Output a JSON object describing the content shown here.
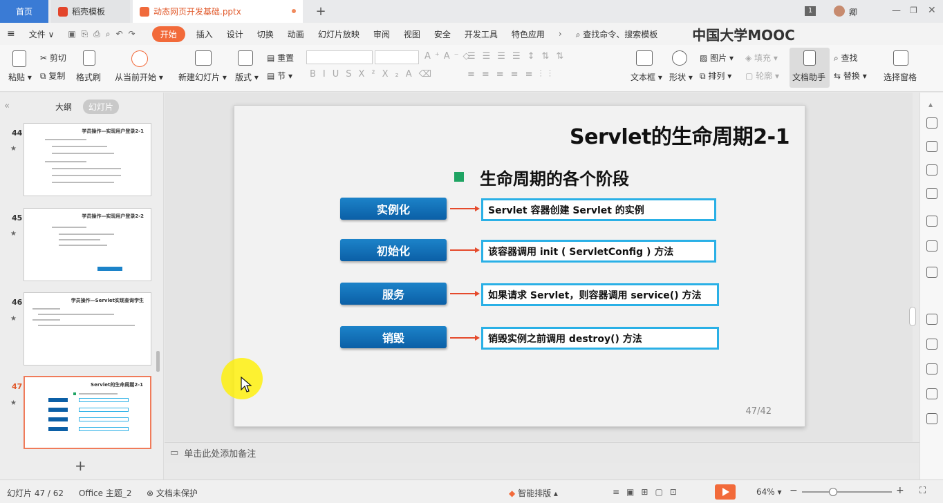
{
  "tabs": {
    "home": "首页",
    "templates": "稻壳模板",
    "document": "动态网页开发基础.pptx",
    "add": "+"
  },
  "titlebar": {
    "badge": "1",
    "user": "卿"
  },
  "menu": {
    "file": "文件",
    "items": [
      "开始",
      "插入",
      "设计",
      "切换",
      "动画",
      "幻灯片放映",
      "审阅",
      "视图",
      "安全",
      "开发工具",
      "特色应用"
    ],
    "search": "查找命令、搜索模板",
    "watermark": "中国大学MOOC"
  },
  "ribbon": {
    "paste": "粘贴",
    "cut": "剪切",
    "copy": "复制",
    "format_painter": "格式刷",
    "from_current": "从当前开始",
    "new_slide": "新建幻灯片",
    "layout": "版式",
    "reset": "重置",
    "section": "节",
    "textbox": "文本框",
    "shape": "形状",
    "picture": "图片",
    "arrange": "排列",
    "fill": "填充",
    "outline": "轮廓",
    "doc_assistant": "文档助手",
    "find": "查找",
    "replace": "替换",
    "selection_pane": "选择窗格"
  },
  "left_panel": {
    "outline_tab": "大纲",
    "slides_tab": "幻灯片",
    "thumbnails": [
      {
        "num": "44",
        "title": "学员操作—实现用户登录2-1"
      },
      {
        "num": "45",
        "title": "学员操作—实现用户登录2-2"
      },
      {
        "num": "46",
        "title": "学员操作—Servlet实现查询学生"
      },
      {
        "num": "47",
        "title": "Servlet的生命周期2-1"
      }
    ],
    "star": "★"
  },
  "slide": {
    "title": "Servlet的生命周期2-1",
    "bullet": "生命周期的各个阶段",
    "stages": [
      {
        "label": "实例化",
        "desc": "Servlet 容器创建 Servlet 的实例"
      },
      {
        "label": "初始化",
        "desc": "该容器调用 init ( ServletConfig ) 方法"
      },
      {
        "label": "服务",
        "desc": "如果请求 Servlet，则容器调用 service() 方法"
      },
      {
        "label": "销毁",
        "desc": "销毁实例之前调用 destroy() 方法"
      }
    ],
    "page": "47/42"
  },
  "notes": {
    "placeholder": "单击此处添加备注"
  },
  "status": {
    "slide_count": "幻灯片 47 / 62",
    "theme": "Office 主题_2",
    "protect": "文档未保护",
    "smart_layout": "智能排版",
    "zoom": "64%"
  },
  "colors": {
    "accent": "#f26a3a",
    "stage_blue": "#0b5fa6",
    "desc_border": "#2ab0e6",
    "arrow": "#e54a2c",
    "bullet": "#1fa463"
  }
}
